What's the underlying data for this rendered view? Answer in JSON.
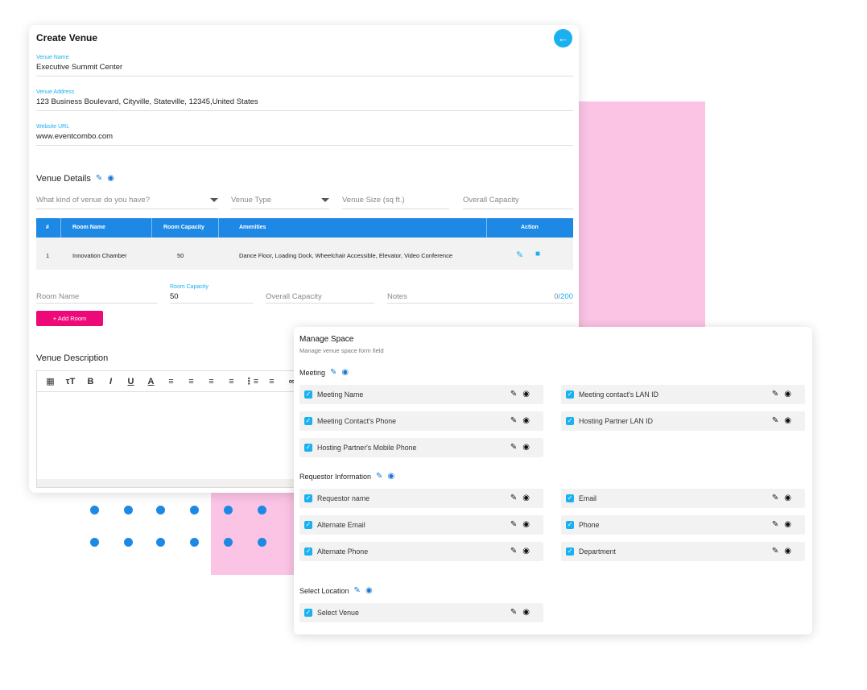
{
  "create_venue": {
    "title": "Create Venue",
    "back_icon": "arrow-left-icon",
    "venue_name": {
      "label": "Venue Name",
      "value": "Executive Summit Center"
    },
    "venue_address": {
      "label": "Venue Address",
      "value": "123 Business Boulevard, Cityville, Stateville, 12345,United States"
    },
    "website_url": {
      "label": "Website URL",
      "value": "www.eventcombo.com"
    },
    "venue_details": {
      "heading": "Venue Details",
      "kind_placeholder": "What kind of venue do you have?",
      "type_placeholder": "Venue Type",
      "size_placeholder": "Venue Size (sq ft.)",
      "capacity_placeholder": "Overall Capacity"
    },
    "table": {
      "headers": [
        "#",
        "Room Name",
        "Room Capacity",
        "Amenities",
        "Action"
      ],
      "rows": [
        {
          "num": "1",
          "room_name": "Innovation Chamber",
          "room_capacity": "50",
          "amenities": "Dance Floor, Loading Dock, Wheelchair Accessible, Elevator, Video Conference"
        }
      ]
    },
    "room_form": {
      "room_name_placeholder": "Room Name",
      "room_capacity_label": "Room Capacity",
      "room_capacity_value": "50",
      "overall_capacity_placeholder": "Overall Capacity",
      "notes_placeholder": "Notes",
      "notes_counter_current": "0",
      "notes_counter_max": "/200"
    },
    "add_room_label": "+ Add Room",
    "description_heading": "Venue Description",
    "toolbar_icons": [
      "translate-icon",
      "text-size-icon",
      "bold-icon",
      "italic-icon",
      "underline-icon",
      "font-color-icon",
      "align-left-icon",
      "align-center-icon",
      "align-right-icon",
      "align-justify-icon",
      "bullet-list-icon",
      "numbered-list-icon",
      "link-icon"
    ]
  },
  "manage_space": {
    "title": "Manage Space",
    "subtitle": "Manage venue space form field",
    "groups": {
      "meeting": {
        "heading": "Meeting",
        "items": [
          "Meeting Name",
          "Meeting contact's LAN ID",
          "Meeting Contact's Phone",
          "Hosting Partner LAN ID",
          "Hosting Partner's Mobile Phone"
        ]
      },
      "requestor": {
        "heading": "Requestor Information",
        "items": [
          "Requestor name",
          "Email",
          "Alternate Email",
          "Phone",
          "Alternate Phone",
          "Department"
        ]
      },
      "location": {
        "heading": "Select Location",
        "items": [
          "Select Venue"
        ]
      }
    }
  },
  "colors": {
    "accent": "#1ab1f0",
    "table_header": "#1e88e5",
    "add_button": "#ee0979",
    "decor_pink": "#fbc3e4",
    "decor_dots": "#1e88e5"
  }
}
